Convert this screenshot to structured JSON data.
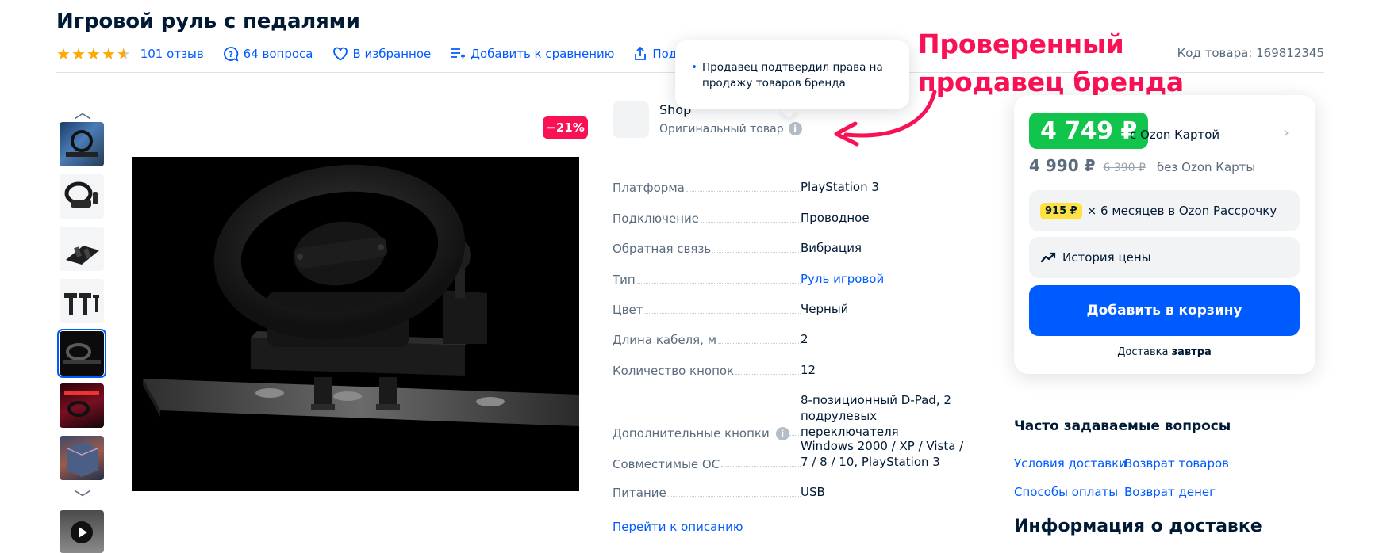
{
  "product": {
    "title": "Игровой руль с педалями",
    "rating": 4.5,
    "reviews": "101 отзыв",
    "questions": "64 вопроса",
    "favorite": "В избранное",
    "compare": "Добавить к сравнению",
    "share": "Поделиться",
    "sku": "Код товара: 169812345",
    "discount": "−21%"
  },
  "seller": {
    "name": "Shop",
    "original": "Оригинальный товар",
    "tooltip": "Продавец подтвердил права на продажу товаров бренда"
  },
  "annotation": {
    "line1": "Проверенный",
    "line2": "продавец бренда",
    "color": "#f91155"
  },
  "specs": [
    {
      "name": "Платформа",
      "value": "PlayStation 3"
    },
    {
      "name": "Подключение",
      "value": "Проводное"
    },
    {
      "name": "Обратная связь",
      "value": "Вибрация"
    },
    {
      "name": "Тип",
      "value": "Руль игровой"
    },
    {
      "name": "Цвет",
      "value": "Черный"
    },
    {
      "name": "Длина кабеля, м",
      "value": "2"
    },
    {
      "name": "Количество кнопок",
      "value": "12"
    },
    {
      "name": "Дополнительные кнопки",
      "value": "8-позиционный D-Pad, 2 подрулевых переключателя"
    },
    {
      "name": "Совместимые ОС",
      "value": "Windows 2000 / XP / Vista / 7 / 8 / 10, PlayStation 3"
    },
    {
      "name": "Питание",
      "value": "USB"
    }
  ],
  "goto_description": "Перейти к описанию",
  "price": {
    "ozon_card_price": "4 749 ₽",
    "ozon_card_label": "с Ozon Картой",
    "regular_price": "4 990 ₽",
    "old_price": "6 390 ₽",
    "regular_label": "без Ozon Карты",
    "installment_amount": "915 ₽",
    "installment_text": "× 6 месяцев в Ozon Рассрочку",
    "history": "История цены",
    "add_to_cart": "Добавить в корзину",
    "delivery_label": "Доставка",
    "delivery_when": "завтра"
  },
  "faq": {
    "title": "Часто задаваемые вопросы",
    "links": [
      "Условия доставки",
      "Возврат товаров",
      "Способы оплаты",
      "Возврат денег"
    ]
  },
  "delivery_info_title": "Информация о доставке",
  "colors": {
    "accent": "#005bff",
    "green": "#10c44c",
    "discount": "#f91155",
    "star": "#ffa800",
    "installment_chip": "#ffe13f"
  }
}
